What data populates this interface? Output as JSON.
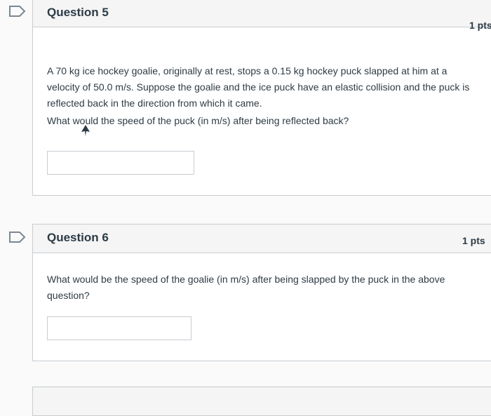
{
  "questions": [
    {
      "title": "Question 5",
      "points": "1 pts",
      "text": "A 70 kg ice hockey goalie, originally at rest, stops a 0.15 kg hockey puck slapped at him at a velocity of 50.0 m/s. Suppose the goalie and the ice puck have an elastic collision and the puck is reflected back in the direction from which it came.",
      "prompt": "What would the speed of the puck (in m/s) after being reflected back?",
      "answer": ""
    },
    {
      "title": "Question 6",
      "points": "1 pts",
      "text": "What would be the speed of the goalie (in m/s) after being slapped by the puck in the above question?",
      "answer": ""
    }
  ],
  "icons": {
    "flag": "flag-icon",
    "cursor": "mouse-cursor-icon"
  },
  "colors": {
    "header_bg": "#f5f5f5",
    "border": "#c7cdd1",
    "text": "#2d3b45",
    "flag_stroke": "#7a8793"
  }
}
